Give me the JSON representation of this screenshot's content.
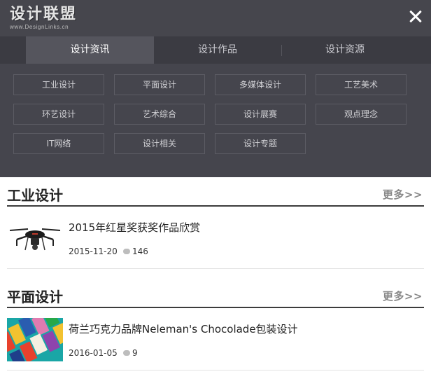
{
  "logo": {
    "main": "设计联盟",
    "sub": "www.DesignLinks.cn"
  },
  "tabs": [
    {
      "label": "设计资讯",
      "active": true
    },
    {
      "label": "设计作品",
      "active": false
    },
    {
      "label": "设计资源",
      "active": false
    }
  ],
  "categories": [
    "工业设计",
    "平面设计",
    "多媒体设计",
    "工艺美术",
    "环艺设计",
    "艺术综合",
    "设计展赛",
    "观点理念",
    "IT网络",
    "设计相关",
    "设计专题"
  ],
  "sections": [
    {
      "title": "工业设计",
      "more": "更多>>",
      "articles": [
        {
          "title": "2015年红星奖获奖作品欣赏",
          "date": "2015-11-20",
          "comments": "146",
          "thumb_icon": "drone-image"
        }
      ]
    },
    {
      "title": "平面设计",
      "more": "更多>>",
      "articles": [
        {
          "title": "荷兰巧克力品牌Neleman's Chocolade包装设计",
          "date": "2016-01-05",
          "comments": "9",
          "thumb_icon": "chocolate-packaging-image"
        }
      ]
    }
  ],
  "colors": {
    "menu_bg": "#45454d",
    "tab_bar": "#3b3b42",
    "tab_active": "#55555d",
    "section_rule": "#3c3c3c"
  }
}
